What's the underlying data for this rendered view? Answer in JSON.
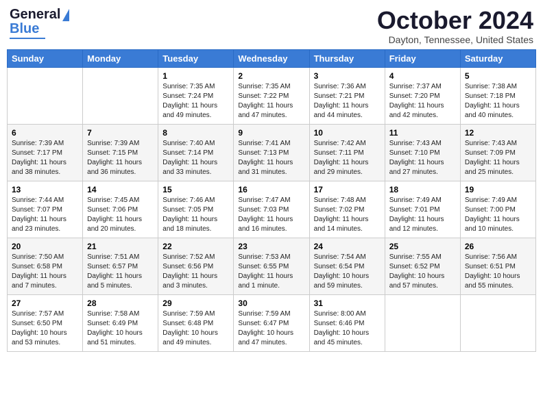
{
  "header": {
    "logo_line1": "General",
    "logo_line2": "Blue",
    "title": "October 2024",
    "subtitle": "Dayton, Tennessee, United States"
  },
  "days_of_week": [
    "Sunday",
    "Monday",
    "Tuesday",
    "Wednesday",
    "Thursday",
    "Friday",
    "Saturday"
  ],
  "weeks": [
    [
      {
        "day": "",
        "detail": ""
      },
      {
        "day": "",
        "detail": ""
      },
      {
        "day": "1",
        "detail": "Sunrise: 7:35 AM\nSunset: 7:24 PM\nDaylight: 11 hours and 49 minutes."
      },
      {
        "day": "2",
        "detail": "Sunrise: 7:35 AM\nSunset: 7:22 PM\nDaylight: 11 hours and 47 minutes."
      },
      {
        "day": "3",
        "detail": "Sunrise: 7:36 AM\nSunset: 7:21 PM\nDaylight: 11 hours and 44 minutes."
      },
      {
        "day": "4",
        "detail": "Sunrise: 7:37 AM\nSunset: 7:20 PM\nDaylight: 11 hours and 42 minutes."
      },
      {
        "day": "5",
        "detail": "Sunrise: 7:38 AM\nSunset: 7:18 PM\nDaylight: 11 hours and 40 minutes."
      }
    ],
    [
      {
        "day": "6",
        "detail": "Sunrise: 7:39 AM\nSunset: 7:17 PM\nDaylight: 11 hours and 38 minutes."
      },
      {
        "day": "7",
        "detail": "Sunrise: 7:39 AM\nSunset: 7:15 PM\nDaylight: 11 hours and 36 minutes."
      },
      {
        "day": "8",
        "detail": "Sunrise: 7:40 AM\nSunset: 7:14 PM\nDaylight: 11 hours and 33 minutes."
      },
      {
        "day": "9",
        "detail": "Sunrise: 7:41 AM\nSunset: 7:13 PM\nDaylight: 11 hours and 31 minutes."
      },
      {
        "day": "10",
        "detail": "Sunrise: 7:42 AM\nSunset: 7:11 PM\nDaylight: 11 hours and 29 minutes."
      },
      {
        "day": "11",
        "detail": "Sunrise: 7:43 AM\nSunset: 7:10 PM\nDaylight: 11 hours and 27 minutes."
      },
      {
        "day": "12",
        "detail": "Sunrise: 7:43 AM\nSunset: 7:09 PM\nDaylight: 11 hours and 25 minutes."
      }
    ],
    [
      {
        "day": "13",
        "detail": "Sunrise: 7:44 AM\nSunset: 7:07 PM\nDaylight: 11 hours and 23 minutes."
      },
      {
        "day": "14",
        "detail": "Sunrise: 7:45 AM\nSunset: 7:06 PM\nDaylight: 11 hours and 20 minutes."
      },
      {
        "day": "15",
        "detail": "Sunrise: 7:46 AM\nSunset: 7:05 PM\nDaylight: 11 hours and 18 minutes."
      },
      {
        "day": "16",
        "detail": "Sunrise: 7:47 AM\nSunset: 7:03 PM\nDaylight: 11 hours and 16 minutes."
      },
      {
        "day": "17",
        "detail": "Sunrise: 7:48 AM\nSunset: 7:02 PM\nDaylight: 11 hours and 14 minutes."
      },
      {
        "day": "18",
        "detail": "Sunrise: 7:49 AM\nSunset: 7:01 PM\nDaylight: 11 hours and 12 minutes."
      },
      {
        "day": "19",
        "detail": "Sunrise: 7:49 AM\nSunset: 7:00 PM\nDaylight: 11 hours and 10 minutes."
      }
    ],
    [
      {
        "day": "20",
        "detail": "Sunrise: 7:50 AM\nSunset: 6:58 PM\nDaylight: 11 hours and 7 minutes."
      },
      {
        "day": "21",
        "detail": "Sunrise: 7:51 AM\nSunset: 6:57 PM\nDaylight: 11 hours and 5 minutes."
      },
      {
        "day": "22",
        "detail": "Sunrise: 7:52 AM\nSunset: 6:56 PM\nDaylight: 11 hours and 3 minutes."
      },
      {
        "day": "23",
        "detail": "Sunrise: 7:53 AM\nSunset: 6:55 PM\nDaylight: 11 hours and 1 minute."
      },
      {
        "day": "24",
        "detail": "Sunrise: 7:54 AM\nSunset: 6:54 PM\nDaylight: 10 hours and 59 minutes."
      },
      {
        "day": "25",
        "detail": "Sunrise: 7:55 AM\nSunset: 6:52 PM\nDaylight: 10 hours and 57 minutes."
      },
      {
        "day": "26",
        "detail": "Sunrise: 7:56 AM\nSunset: 6:51 PM\nDaylight: 10 hours and 55 minutes."
      }
    ],
    [
      {
        "day": "27",
        "detail": "Sunrise: 7:57 AM\nSunset: 6:50 PM\nDaylight: 10 hours and 53 minutes."
      },
      {
        "day": "28",
        "detail": "Sunrise: 7:58 AM\nSunset: 6:49 PM\nDaylight: 10 hours and 51 minutes."
      },
      {
        "day": "29",
        "detail": "Sunrise: 7:59 AM\nSunset: 6:48 PM\nDaylight: 10 hours and 49 minutes."
      },
      {
        "day": "30",
        "detail": "Sunrise: 7:59 AM\nSunset: 6:47 PM\nDaylight: 10 hours and 47 minutes."
      },
      {
        "day": "31",
        "detail": "Sunrise: 8:00 AM\nSunset: 6:46 PM\nDaylight: 10 hours and 45 minutes."
      },
      {
        "day": "",
        "detail": ""
      },
      {
        "day": "",
        "detail": ""
      }
    ]
  ]
}
